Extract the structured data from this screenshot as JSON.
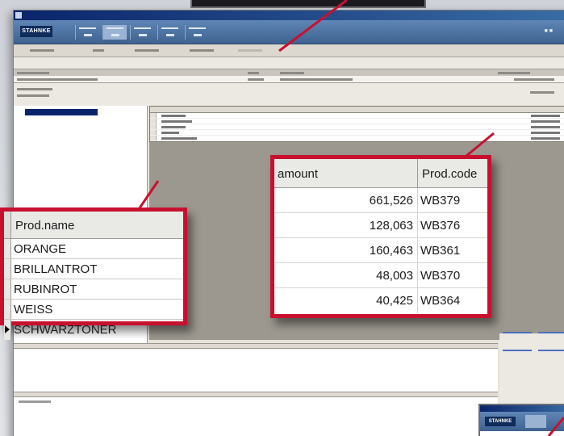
{
  "app": {
    "logo_text": "STAHNKE",
    "mini_logo_text": "STAHNKE"
  },
  "names_callout": {
    "header": "Prod.name",
    "rows": [
      "ORANGE",
      "BRILLANTROT",
      "RUBINROT",
      "WEISS",
      "SCHWARZTONER"
    ],
    "current_row_index": 4
  },
  "amounts_callout": {
    "headers": {
      "amount": "amount",
      "code": "Prod.code"
    },
    "rows": [
      {
        "amount": "661,526",
        "code": "WB379"
      },
      {
        "amount": "128,063",
        "code": "WB376"
      },
      {
        "amount": "160,463",
        "code": "WB361"
      },
      {
        "amount": "48,003",
        "code": "WB370"
      },
      {
        "amount": "40,425",
        "code": "WB364"
      }
    ]
  },
  "colors": {
    "callout_border": "#c8102e",
    "ribbon": "#4f76a6",
    "selection": "#0a246a"
  }
}
